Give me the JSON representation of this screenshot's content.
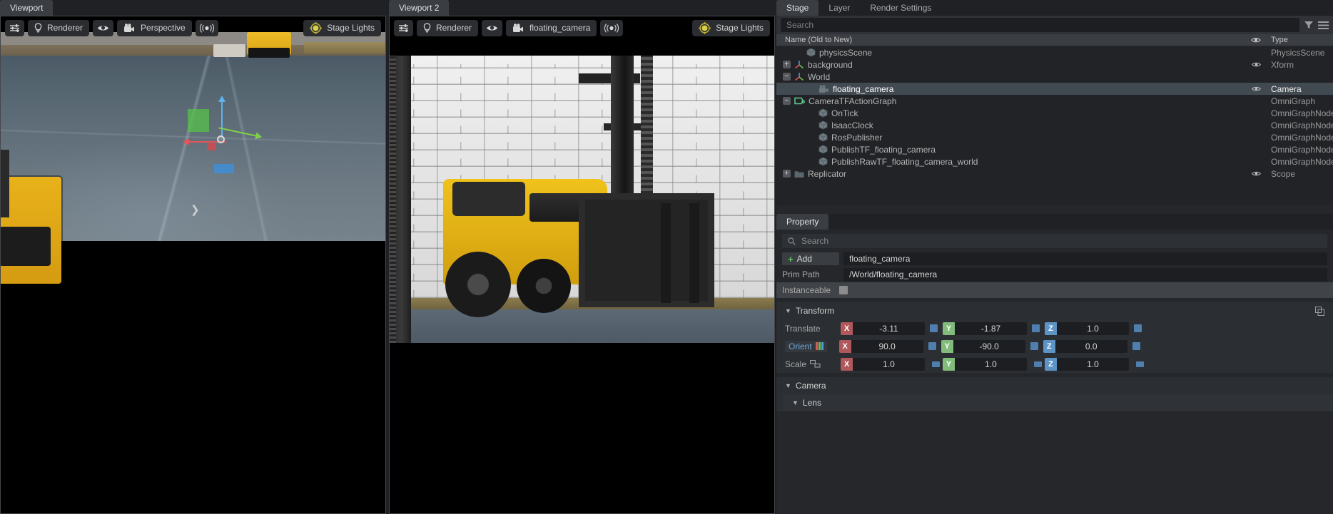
{
  "viewport1": {
    "tab_label": "Viewport",
    "toolbar": {
      "settings_icon": "sliders-icon",
      "renderer_label": "Renderer",
      "eye_icon": "eye-icon",
      "camera_label": "Perspective",
      "camera_icon": "camera-icon",
      "speaker_icon": "audio-icon",
      "lights_label": "Stage Lights",
      "lights_icon": "sun-icon"
    }
  },
  "viewport2": {
    "tab_label": "Viewport 2",
    "toolbar": {
      "settings_icon": "sliders-icon",
      "renderer_label": "Renderer",
      "eye_icon": "eye-icon",
      "camera_label": "floating_camera",
      "camera_icon": "camera-icon",
      "speaker_icon": "audio-icon",
      "lights_label": "Stage Lights",
      "lights_icon": "sun-icon"
    }
  },
  "stage": {
    "tabs": [
      {
        "label": "Stage",
        "active": true
      },
      {
        "label": "Layer",
        "active": false
      },
      {
        "label": "Render Settings",
        "active": false
      }
    ],
    "search_placeholder": "Search",
    "filter_icon": "filter-icon",
    "options_icon": "hamburger-icon",
    "columns": {
      "name": "Name (Old to New)",
      "visibility": "eye-icon",
      "type": "Type"
    },
    "rows": [
      {
        "name": "physicsScene",
        "type": "PhysicsScene",
        "indent": 1,
        "expander": "none",
        "icon": "mesh-icon",
        "eye": false,
        "selected": false
      },
      {
        "name": "background",
        "type": "Xform",
        "indent": 0,
        "expander": "plus",
        "icon": "xform-icon",
        "eye": true,
        "selected": false
      },
      {
        "name": "World",
        "type": "",
        "indent": 0,
        "expander": "minus",
        "icon": "xform-icon",
        "eye": false,
        "selected": false
      },
      {
        "name": "floating_camera",
        "type": "Camera",
        "indent": 2,
        "expander": "none",
        "icon": "camera-icon",
        "eye": true,
        "selected": true
      },
      {
        "name": "CameraTFActionGraph",
        "type": "OmniGraph",
        "indent": 0,
        "expander": "minus",
        "icon": "graph-icon",
        "eye": false,
        "selected": false
      },
      {
        "name": "OnTick",
        "type": "OmniGraphNode",
        "indent": 2,
        "expander": "none",
        "icon": "mesh-icon",
        "eye": false,
        "selected": false
      },
      {
        "name": "IsaacClock",
        "type": "OmniGraphNode",
        "indent": 2,
        "expander": "none",
        "icon": "mesh-icon",
        "eye": false,
        "selected": false
      },
      {
        "name": "RosPublisher",
        "type": "OmniGraphNode",
        "indent": 2,
        "expander": "none",
        "icon": "mesh-icon",
        "eye": false,
        "selected": false
      },
      {
        "name": "PublishTF_floating_camera",
        "type": "OmniGraphNode",
        "indent": 2,
        "expander": "none",
        "icon": "mesh-icon",
        "eye": false,
        "selected": false
      },
      {
        "name": "PublishRawTF_floating_camera_world",
        "type": "OmniGraphNode",
        "indent": 2,
        "expander": "none",
        "icon": "mesh-icon",
        "eye": false,
        "selected": false
      },
      {
        "name": "Replicator",
        "type": "Scope",
        "indent": 0,
        "expander": "plus",
        "icon": "folder-icon",
        "eye": true,
        "selected": false
      }
    ]
  },
  "property": {
    "tab_label": "Property",
    "search_placeholder": "Search",
    "search_icon": "search-icon",
    "add_label": "Add",
    "add_icon": "plus-icon",
    "name_value": "floating_camera",
    "prim_path_label": "Prim Path",
    "prim_path_value": "/World/floating_camera",
    "instanceable_label": "Instanceable",
    "instanceable_checked": false,
    "transform": {
      "title": "Transform",
      "reset_icon": "reset-transform-icon",
      "rows": [
        {
          "label": "Translate",
          "chip": false,
          "x": "-3.11",
          "y": "-1.87",
          "z": "1.0"
        },
        {
          "label": "Orient",
          "chip": true,
          "badge_icon": "rgb-bars-icon",
          "x": "90.0",
          "y": "-90.0",
          "z": "0.0"
        },
        {
          "label": "Scale",
          "chip": false,
          "badge_icon": "link-scale-icon",
          "x": "1.0",
          "y": "1.0",
          "z": "1.0"
        }
      ]
    },
    "camera": {
      "title": "Camera",
      "lens_title": "Lens"
    }
  },
  "colors": {
    "axis_x": "#b0585c",
    "axis_y": "#81bc7a",
    "axis_z": "#5d94c6",
    "accent_blue": "#6aa7d8",
    "add_green": "#5dc35d",
    "selection": "#414a50"
  }
}
